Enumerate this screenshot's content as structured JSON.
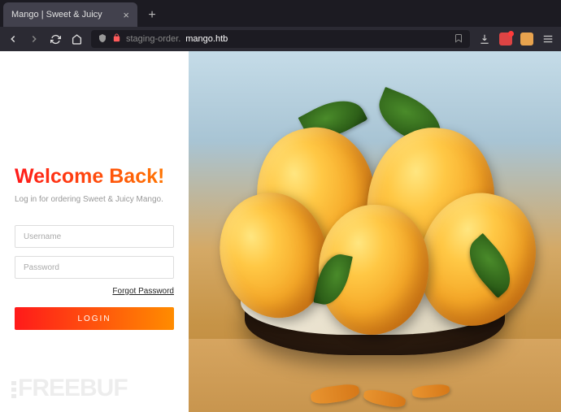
{
  "browser": {
    "tab": {
      "title": "Mango | Sweet & Juicy"
    },
    "url": {
      "prefix": "staging-order.",
      "domain": "mango.htb"
    }
  },
  "login": {
    "title": "Welcome Back!",
    "subtitle": "Log in for ordering Sweet & Juicy Mango.",
    "username_placeholder": "Username",
    "password_placeholder": "Password",
    "forgot_label": "Forgot Password",
    "button_label": "LOGIN"
  },
  "watermark": {
    "text": "FREEBUF"
  },
  "colors": {
    "gradient_start": "#ff1a1a",
    "gradient_end": "#ff8c00"
  }
}
